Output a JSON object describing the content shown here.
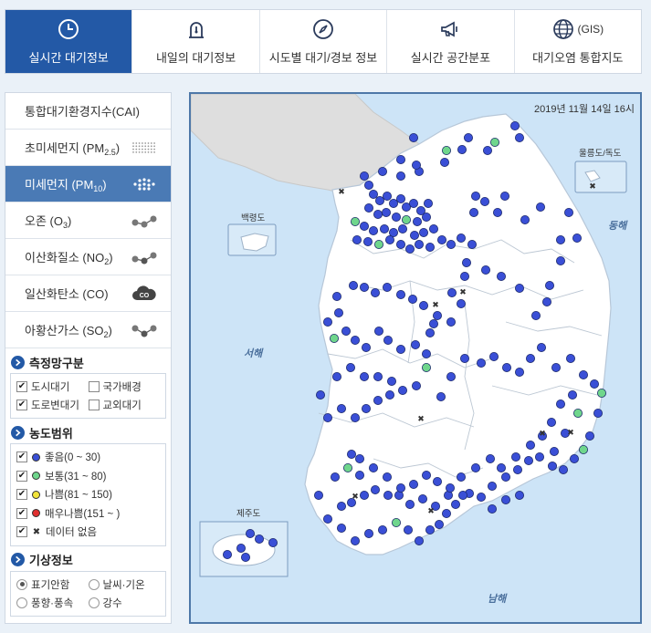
{
  "tabs": [
    {
      "label": "실시간 대기정보",
      "icon": "clock-icon",
      "active": true
    },
    {
      "label": "내일의 대기정보",
      "icon": "forecast-icon",
      "active": false
    },
    {
      "label": "시도별 대기/경보 정보",
      "icon": "compass-icon",
      "active": false
    },
    {
      "label": "실시간 공간분포",
      "icon": "megaphone-icon",
      "active": false
    },
    {
      "label": "대기오염 통합지도",
      "icon": "globe-icon",
      "icon_text": "(GIS)",
      "active": false
    }
  ],
  "pollutants": [
    {
      "label": "통합대기환경지수(CAI)",
      "icon": "none"
    },
    {
      "label": "초미세먼지 (PM",
      "sub": "2.5",
      "tail": ")",
      "icon": "fine-dots-icon"
    },
    {
      "label": "미세먼지 (PM",
      "sub": "10",
      "tail": ")",
      "icon": "dots-icon",
      "active": true
    },
    {
      "label": "오존 (O",
      "sub": "3",
      "tail": ")",
      "icon": "molecule-icon"
    },
    {
      "label": "이산화질소 (NO",
      "sub": "2",
      "tail": ")",
      "icon": "molecule-icon"
    },
    {
      "label": "일산화탄소 (CO)",
      "icon": "co-cloud-icon"
    },
    {
      "label": "아황산가스 (SO",
      "sub": "2",
      "tail": ")",
      "icon": "molecule-icon"
    }
  ],
  "network": {
    "title": "측정망구분",
    "options": [
      {
        "label": "도시대기",
        "checked": true
      },
      {
        "label": "국가배경",
        "checked": false
      },
      {
        "label": "도로변대기",
        "checked": true
      },
      {
        "label": "교외대기",
        "checked": false
      }
    ]
  },
  "range": {
    "title": "농도범위",
    "items": [
      {
        "label": "좋음(0 ~ 30)",
        "color": "#3a4fd6",
        "checked": true
      },
      {
        "label": "보통(31 ~ 80)",
        "color": "#6fd68c",
        "checked": true
      },
      {
        "label": "나쁨(81 ~ 150)",
        "color": "#f2e43a",
        "checked": true
      },
      {
        "label": "매우나쁨(151 ~ )",
        "color": "#e03030",
        "checked": true
      },
      {
        "label": "데이터 없음",
        "color": "none",
        "checked": true
      }
    ]
  },
  "weather": {
    "title": "기상정보",
    "options": [
      {
        "label": "표기안함",
        "selected": true
      },
      {
        "label": "날씨·기온",
        "selected": false
      },
      {
        "label": "풍향·풍속",
        "selected": false
      },
      {
        "label": "강수",
        "selected": false
      }
    ]
  },
  "map": {
    "timestamp": "2019년 11월 14일 16시",
    "labels": {
      "east_sea": "동해",
      "west_sea": "서해",
      "south_sea": "남해",
      "baengnyeong": "백령도",
      "ulleung": "울릉도/독도",
      "jeju": "제주도"
    },
    "colors": {
      "good": "#3a4fd6",
      "normal": "#6fd68c",
      "land": "#ffffff",
      "sea": "#cde4f7",
      "north": "#dedede"
    }
  }
}
